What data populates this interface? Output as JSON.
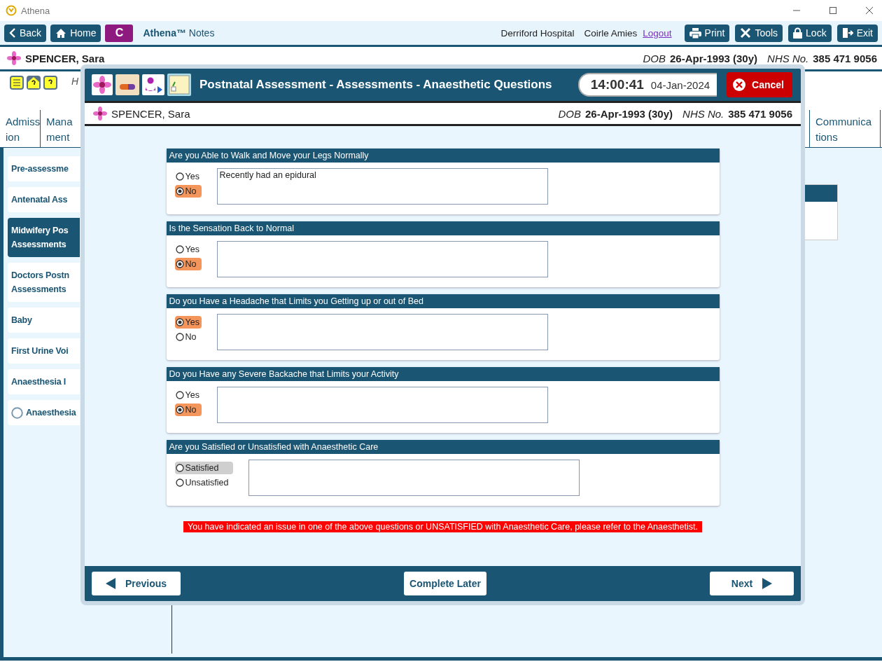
{
  "window": {
    "title": "Athena"
  },
  "toolbar": {
    "buttons": [
      {
        "kind": "back",
        "label": "Back"
      },
      {
        "kind": "home",
        "label": "Home"
      }
    ],
    "badge": "C",
    "app_name": "**Athena™** Notes",
    "site": "Derriford Hospital",
    "user": "Coirle Amies",
    "logout": "Logout",
    "actions": [
      {
        "kind": "print",
        "label": "Print"
      },
      {
        "kind": "tools",
        "label": "Tools"
      },
      {
        "kind": "lock",
        "label": "Lock"
      },
      {
        "kind": "exit",
        "label": "Exit"
      }
    ]
  },
  "patient": {
    "name": "SPENCER, Sara",
    "dob_label": "DOB",
    "dob": "26-Apr-1993 (30y)",
    "nhs_label": "NHS No.",
    "nhs": "385 471 9056"
  },
  "alerts": {
    "note": "H"
  },
  "tabs": [
    {
      "label": "Admiss\nion",
      "selected": false
    },
    {
      "label": "Mana\nment",
      "selected": false
    },
    {
      "label": "Communica\ntions",
      "selected": false
    }
  ],
  "sidebar": {
    "items": [
      {
        "kind": "plain",
        "label": "Pre-assessme",
        "selected": false
      },
      {
        "kind": "plain",
        "label": "Antenatal Ass",
        "selected": false
      },
      {
        "kind": "plain",
        "label": "Midwifery Pos\nAssessments",
        "selected": true
      },
      {
        "kind": "plain",
        "label": "Doctors Postn\nAssessments",
        "selected": false
      },
      {
        "kind": "plain",
        "label": "Baby",
        "selected": false
      },
      {
        "kind": "plain",
        "label": "First Urine Voi",
        "selected": false
      },
      {
        "kind": "plain",
        "label": "Anaesthesia I",
        "selected": false
      },
      {
        "kind": "radio",
        "label": "Anaesthesia",
        "selected": false
      }
    ]
  },
  "dialog": {
    "title": "Postnatal Assessment - Assessments - Anaesthetic Questions",
    "time": "14:00:41",
    "date": "04-Jan-2024",
    "cancel": "Cancel",
    "patient": {
      "name": "SPENCER, Sara",
      "dob_label": "DOB",
      "dob": "26-Apr-1993 (30y)",
      "nhs_label": "NHS No.",
      "nhs": "385 471 9056"
    },
    "questions": [
      {
        "kind": "yesno",
        "title": "Are you Able to Walk and Move your Legs Normally",
        "comment": "Recently had an epidural",
        "options": [
          {
            "label": "Yes",
            "selected": false,
            "focused": false
          },
          {
            "label": "No",
            "selected": true,
            "focused": false
          }
        ]
      },
      {
        "kind": "yesno",
        "title": "Is the Sensation Back to Normal",
        "options": [
          {
            "label": "Yes",
            "selected": false,
            "focused": false
          },
          {
            "label": "No",
            "selected": true,
            "focused": false
          }
        ]
      },
      {
        "kind": "yesno",
        "title": "Do you Have a Headache that Limits you Getting up or out of Bed",
        "options": [
          {
            "label": "Yes",
            "selected": true,
            "focused": false
          },
          {
            "label": "No",
            "selected": false,
            "focused": false
          }
        ]
      },
      {
        "kind": "yesno",
        "title": "Do you Have any Severe Backache that Limits your Activity",
        "options": [
          {
            "label": "Yes",
            "selected": false,
            "focused": false
          },
          {
            "label": "No",
            "selected": true,
            "focused": false
          }
        ]
      },
      {
        "kind": "satisfaction",
        "title": "Are you Satisfied or Unsatisfied with Anaesthetic Care",
        "options": [
          {
            "label": "Satisfied",
            "selected": false,
            "focused": true
          },
          {
            "label": "Unsatisfied",
            "selected": false,
            "focused": false
          }
        ]
      }
    ],
    "warning": "You have indicated an issue in one of the above questions or UNSATISFIED with Anaesthetic Care, please refer to the Anaesthetist.",
    "footer": {
      "previous": "Previous",
      "later": "Complete Later",
      "next": "Next"
    }
  }
}
